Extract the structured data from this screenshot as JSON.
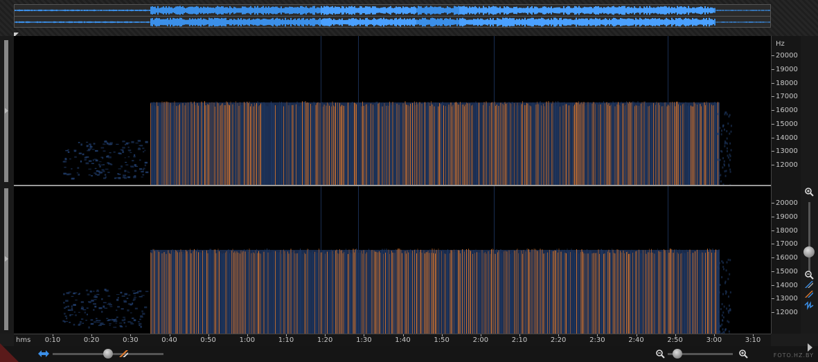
{
  "overview": {
    "accent_color": "#3b8fe8",
    "icon": "waveform-overview"
  },
  "spectrogram": {
    "channels": [
      "left-channel",
      "right-channel"
    ],
    "low_color": "#1f3a66",
    "high_color": "#e07a2e"
  },
  "frequency_axis": {
    "unit": "Hz",
    "channel_1_ticks": [
      "20000",
      "19000",
      "18000",
      "17000",
      "16000",
      "15000",
      "14000",
      "13000",
      "12000"
    ],
    "channel_2_ticks": [
      "20000",
      "19000",
      "18000",
      "17000",
      "16000",
      "15000",
      "14000",
      "13000",
      "12000"
    ]
  },
  "time_axis": {
    "unit": "hms",
    "ticks": [
      "0:10",
      "0:20",
      "0:30",
      "0:40",
      "0:50",
      "1:00",
      "1:10",
      "1:20",
      "1:30",
      "1:40",
      "1:50",
      "2:00",
      "2:10",
      "2:20",
      "2:30",
      "2:40",
      "2:50",
      "3:00",
      "3:10"
    ]
  },
  "tools": {
    "zoom_in_icon": "zoom-in-icon",
    "zoom_out_icon": "zoom-out-icon",
    "vertical_zoom_level": 0.72,
    "horizontal_zoom_level": 0.6,
    "time_zoom_level": 0.15
  },
  "watermark": "FOTO.HZ.BY"
}
